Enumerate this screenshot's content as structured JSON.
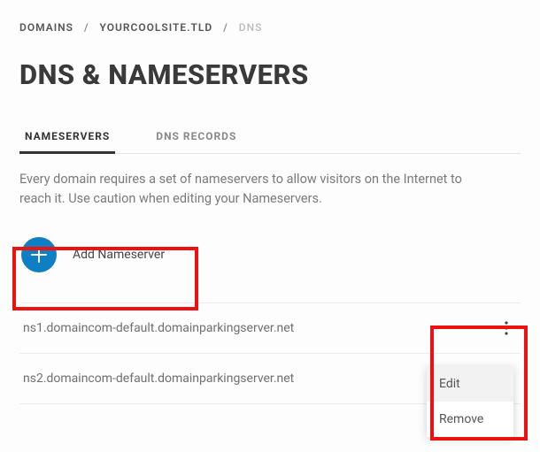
{
  "breadcrumb": {
    "root": "DOMAINS",
    "domain": "YOURCOOLSITE.TLD",
    "current": "DNS"
  },
  "page_title": "DNS & NAMESERVERS",
  "tabs": {
    "nameservers": "NAMESERVERS",
    "dns_records": "DNS RECORDS"
  },
  "description": "Every domain requires a set of nameservers to allow visitors on the Internet to reach it. Use caution when editing your Nameservers.",
  "add_button": "Add Nameserver",
  "nameservers": [
    "ns1.domaincom-default.domainparkingserver.net",
    "ns2.domaincom-default.domainparkingserver.net"
  ],
  "menu": {
    "edit": "Edit",
    "remove": "Remove"
  },
  "colors": {
    "accent": "#0f7fc4",
    "highlight": "#e11"
  }
}
